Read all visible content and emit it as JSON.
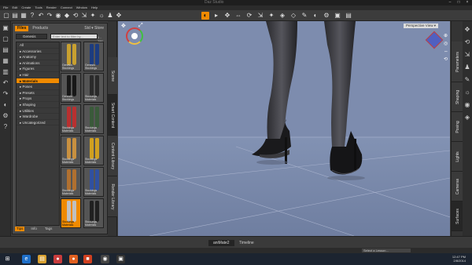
{
  "window": {
    "title": "Daz Studio"
  },
  "menu": [
    "File",
    "Edit",
    "Create",
    "Tools",
    "Render",
    "Connect",
    "Window",
    "Help"
  ],
  "toolbar_icons": [
    "new-icon",
    "open-icon",
    "save-icon",
    "help-icon",
    "undo-icon",
    "redo-icon",
    "camera-icon",
    "node-icon",
    "rotate-icon",
    "scale-icon",
    "joint-icon",
    "light-icon",
    "pose-icon",
    "move-icon",
    "render-icon",
    "select-icon",
    "universal-icon",
    "translate-icon",
    "rotate2-icon",
    "scale2-icon",
    "joint2-icon",
    "surface-icon",
    "geometry-icon",
    "brush-icon",
    "render2-icon",
    "render-settings-icon",
    "render-library-icon",
    "layout-icon",
    "spacer-icon",
    "extra-icon"
  ],
  "content_pane": {
    "tabs": [
      "Files",
      "Products"
    ],
    "active_tab": "Files",
    "menu_label": "Std ▾ Store",
    "category_dropdown": "Genesis",
    "search_placeholder": "Enter text to filter by...",
    "pager": "1 - 286",
    "categories": [
      "Accessories",
      "Anatomy",
      "Animations",
      "Figures",
      "Hair",
      "Materials",
      "Poses",
      "Presets",
      "Props",
      "Shaping",
      "Utilities",
      "Wardrobe",
      "Uncategorized"
    ],
    "all_label": "All",
    "selected_category": "Materials",
    "thumbnails": [
      {
        "caption": "Genesis Stockings",
        "color": "#c8a030",
        "col": 0,
        "row": 0,
        "selected": false
      },
      {
        "caption": "Genesis Stockings",
        "color": "#1c3c80",
        "col": 1,
        "row": 0,
        "selected": false
      },
      {
        "caption": "Genesis Stockings",
        "color": "#181818",
        "col": 0,
        "row": 1,
        "selected": false
      },
      {
        "caption": "Stockings Materials",
        "color": "#2a2a2a",
        "col": 1,
        "row": 1,
        "selected": false
      },
      {
        "caption": "Stockings Materials",
        "color": "#b83030",
        "col": 0,
        "row": 2,
        "selected": false
      },
      {
        "caption": "Stockings Materials",
        "color": "#3a5a3a",
        "col": 1,
        "row": 2,
        "selected": false
      },
      {
        "caption": "Stockings Materials",
        "color": "#c89040",
        "col": 0,
        "row": 3,
        "selected": false
      },
      {
        "caption": "Stockings Materials",
        "color": "#d0a020",
        "col": 1,
        "row": 3,
        "selected": false
      },
      {
        "caption": "Stockings Materials",
        "color": "#b07030",
        "col": 0,
        "row": 4,
        "selected": false
      },
      {
        "caption": "Stockings Materials",
        "color": "#3050a0",
        "col": 1,
        "row": 4,
        "selected": false
      },
      {
        "caption": "Stockings Materials",
        "color": "#c0c0c0",
        "col": 0,
        "row": 5,
        "selected": true
      },
      {
        "caption": "Stockings Materials",
        "color": "#202020",
        "col": 1,
        "row": 5,
        "selected": false
      }
    ],
    "bottom_tabs": [
      "Tips",
      "Info",
      "Tags"
    ],
    "active_bottom_tab": "Tips"
  },
  "left_vtabs": [
    "Scene",
    "Smart Content",
    "Content Library",
    "Render Library"
  ],
  "active_left_vtab": "Smart Content",
  "viewport": {
    "label": "Perspective View ▾"
  },
  "right_vtabs": [
    "Parameters",
    "Shaping",
    "Posing",
    "Lights",
    "Cameras",
    "Surfaces"
  ],
  "active_right_vtab": "Surfaces",
  "timeline": {
    "tab1": "aniMate2",
    "tab2": "Timeline"
  },
  "status": {
    "lesson_placeholder": "Select a Lesson..."
  },
  "taskbar": {
    "apps": [
      {
        "icon": "start-icon",
        "color": "#1c2430",
        "glyph": "⊞"
      },
      {
        "icon": "ie-icon",
        "color": "#1e6fc8",
        "glyph": "e"
      },
      {
        "icon": "folder-icon",
        "color": "#d8a030",
        "glyph": "▤"
      },
      {
        "icon": "chrome-icon",
        "color": "#c83c3c",
        "glyph": "●"
      },
      {
        "icon": "firefox-icon",
        "color": "#e06020",
        "glyph": "●"
      },
      {
        "icon": "office-icon",
        "color": "#d04020",
        "glyph": "■"
      },
      {
        "icon": "daz-icon",
        "color": "#444444",
        "glyph": "◉"
      },
      {
        "icon": "app-icon",
        "color": "#333333",
        "glyph": "▣"
      }
    ],
    "time": "12:47 PM",
    "date": "2/8/2014"
  }
}
